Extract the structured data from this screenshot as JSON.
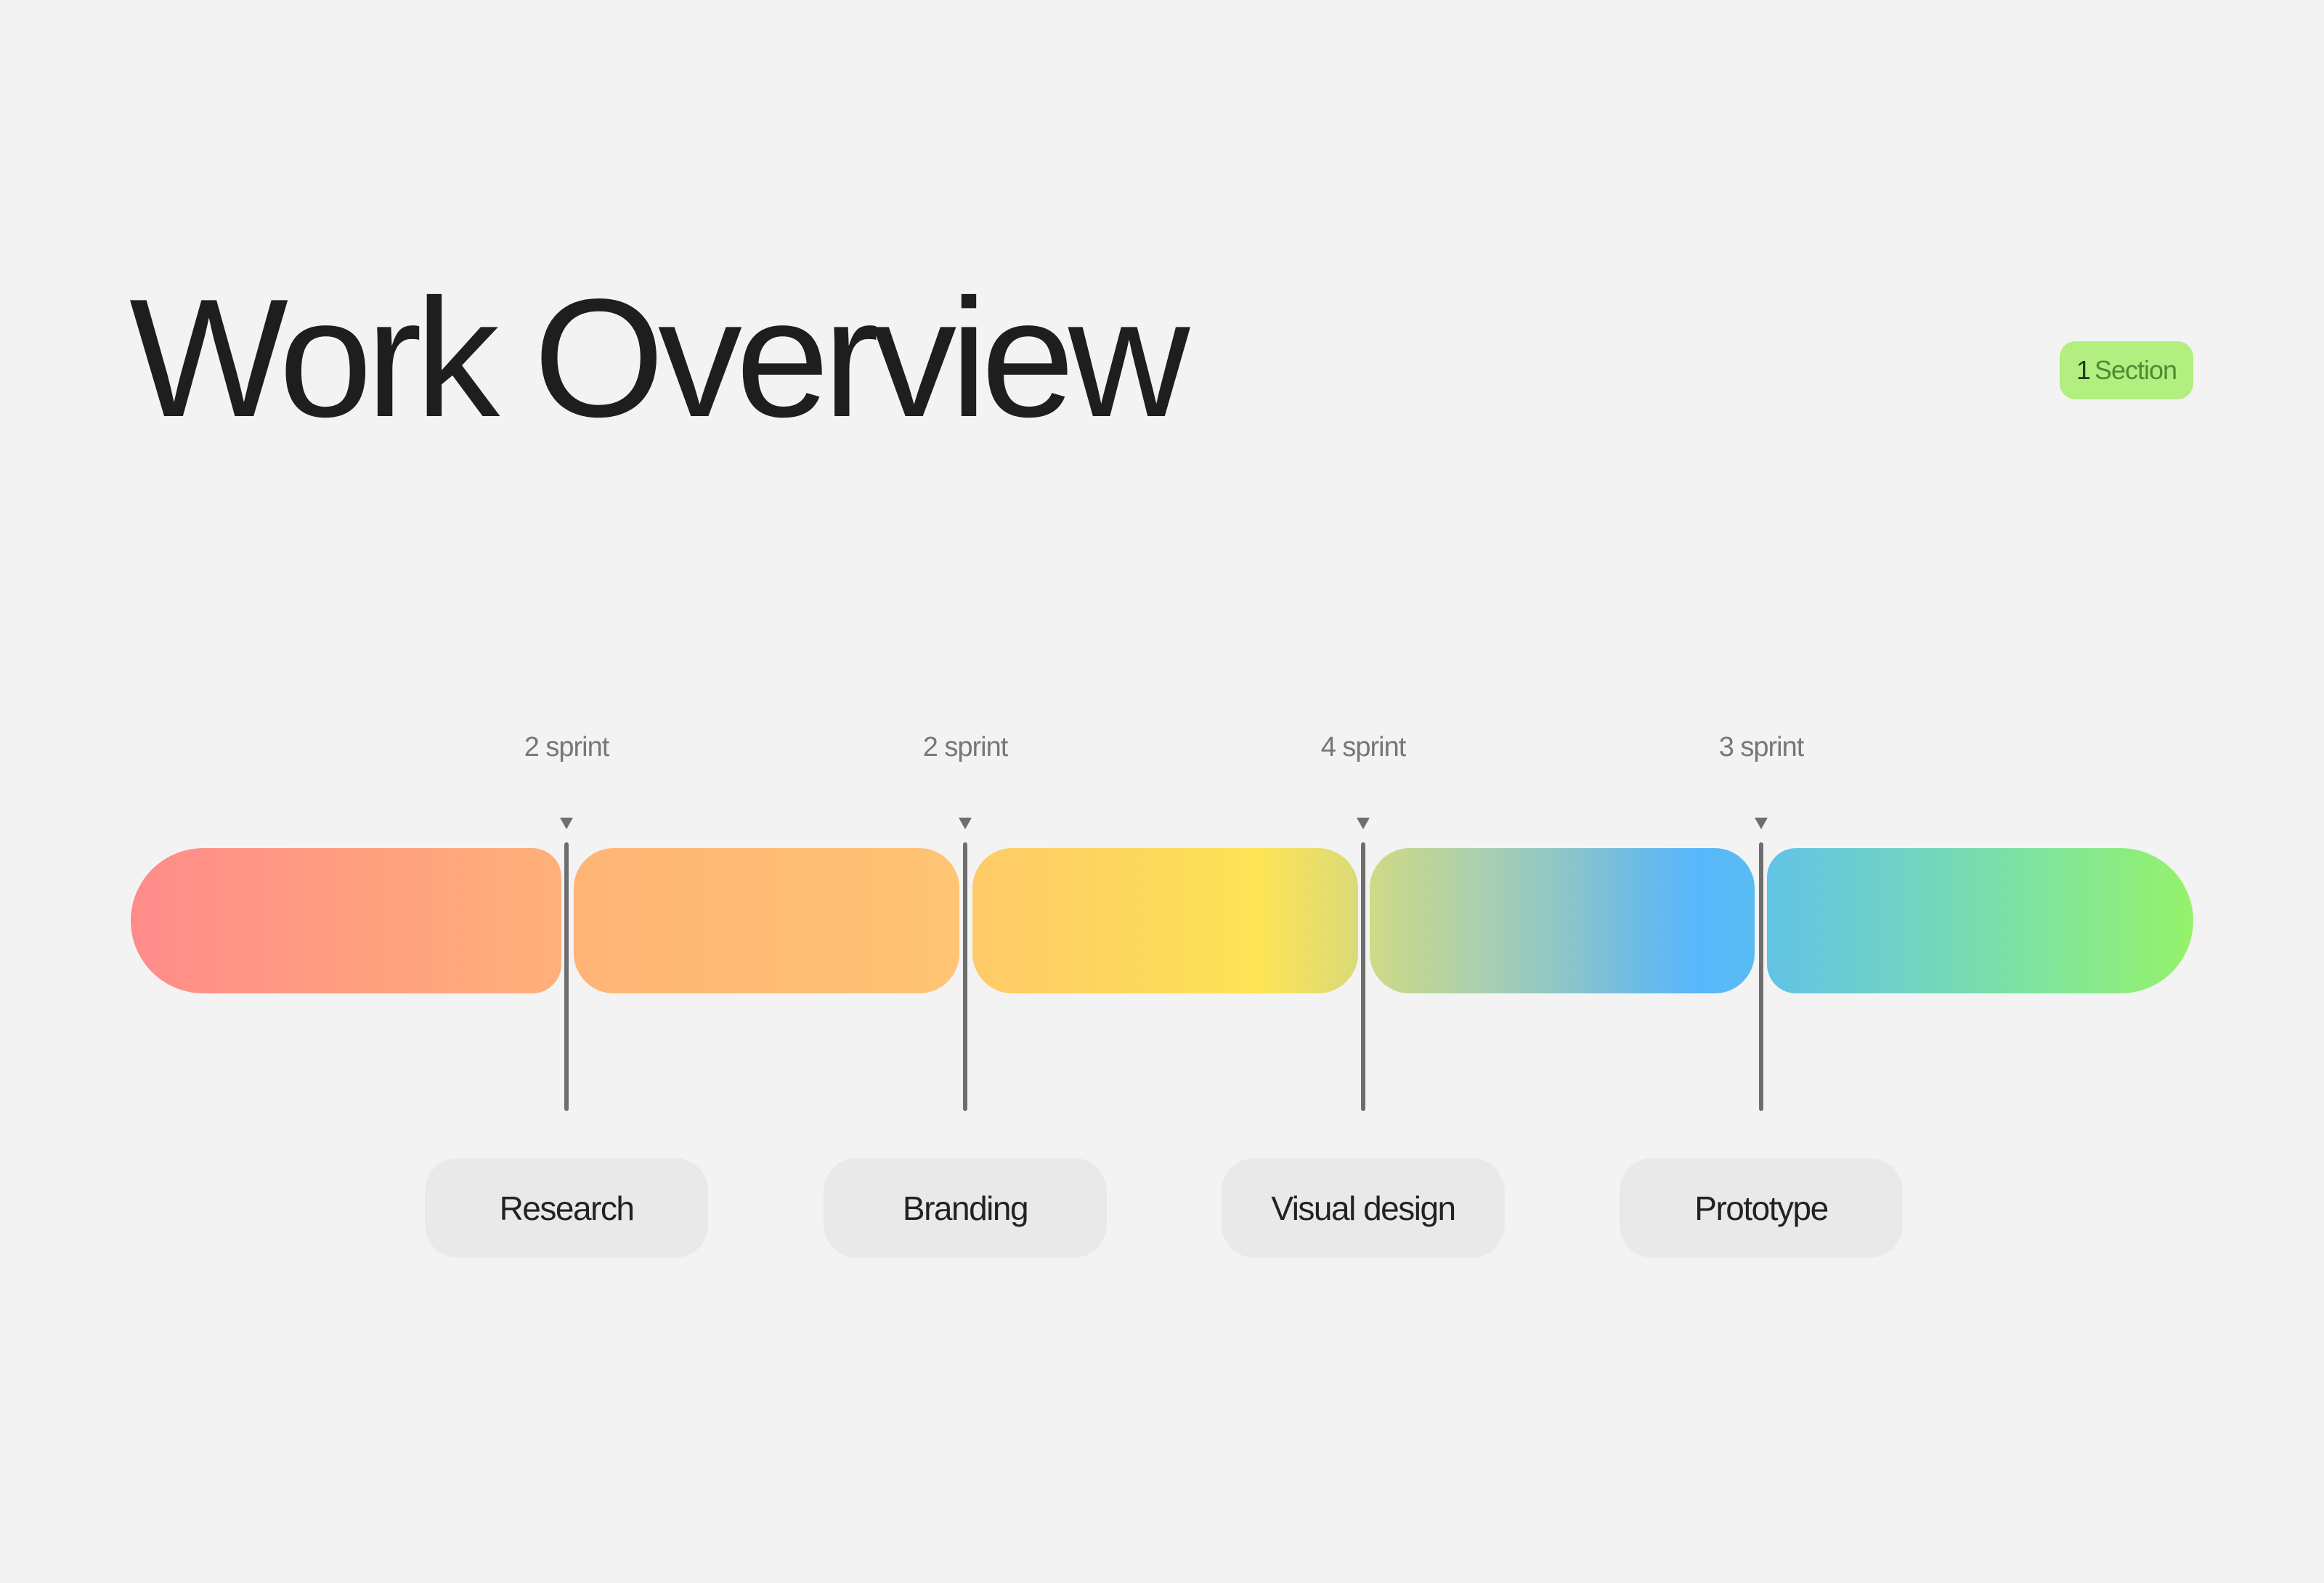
{
  "header": {
    "title": "Work Overview",
    "badge": {
      "number": "1",
      "label": "Section",
      "color": "#b2ee80"
    }
  },
  "timeline": {
    "segments": [
      {
        "name": "segment-1",
        "colors": [
          "#ff8b8b",
          "#ffb07a"
        ]
      },
      {
        "name": "segment-2",
        "colors": [
          "#ffb476",
          "#ffc474"
        ]
      },
      {
        "name": "segment-3",
        "colors": [
          "#ffca68",
          "#fee456",
          "#d9da78"
        ]
      },
      {
        "name": "segment-4",
        "colors": [
          "#cfda85",
          "#58b7fb"
        ]
      },
      {
        "name": "segment-5",
        "colors": [
          "#62c3e6",
          "#95f26a"
        ]
      }
    ],
    "milestones": [
      {
        "duration": "2 sprint",
        "label": "Research"
      },
      {
        "duration": "2 sprint",
        "label": "Branding"
      },
      {
        "duration": "4 sprint",
        "label": "Visual design"
      },
      {
        "duration": "3 sprint",
        "label": "Prototype"
      }
    ]
  }
}
